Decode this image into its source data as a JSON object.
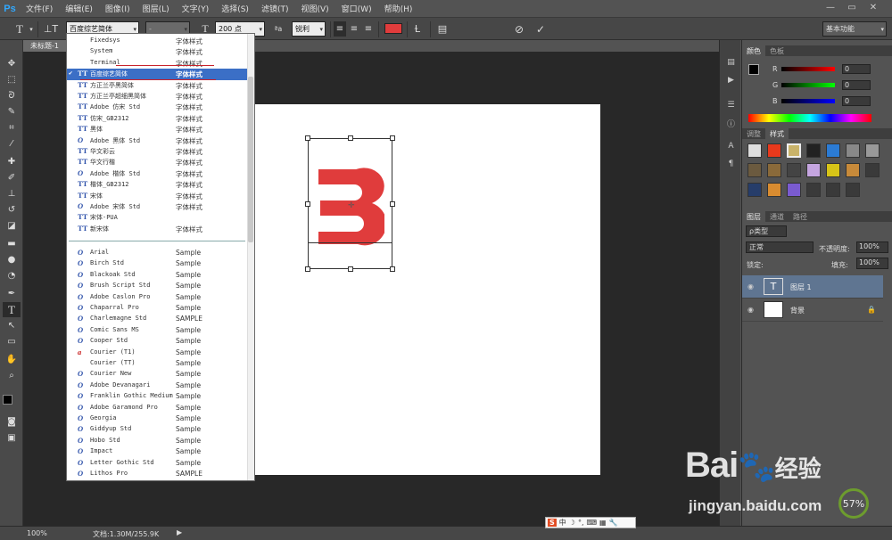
{
  "app": {
    "logo": "Ps"
  },
  "menu": [
    "文件(F)",
    "编辑(E)",
    "图像(I)",
    "图层(L)",
    "文字(Y)",
    "选择(S)",
    "滤镜(T)",
    "视图(V)",
    "窗口(W)",
    "帮助(H)"
  ],
  "window_controls": {
    "minimize": "—",
    "maximize": "▭",
    "close": "✕"
  },
  "options_bar": {
    "font_family": "百度综艺简体",
    "font_style": "-",
    "font_size": "200 点",
    "antialias": "锐利",
    "text_color": "#e03c3c",
    "workspace": "基本功能"
  },
  "document": {
    "tab_title": "未标题-1"
  },
  "font_dropdown": {
    "cjk_fonts": [
      {
        "icon": "",
        "name": "Fixedsys",
        "sample": "字体样式"
      },
      {
        "icon": "",
        "name": "System",
        "sample": "字体样式"
      },
      {
        "icon": "",
        "name": "Terminal",
        "sample": "字体样式"
      },
      {
        "icon": "TT",
        "name": "百度综艺简体",
        "sample": "字体样式",
        "selected": true,
        "check": "✔"
      },
      {
        "icon": "TT",
        "name": "方正兰亭黑简体",
        "sample": "字体样式"
      },
      {
        "icon": "TT",
        "name": "方正兰亭超细黑简体",
        "sample": "字体样式"
      },
      {
        "icon": "TT",
        "name": "Adobe 仿宋 Std",
        "sample": "字体样式"
      },
      {
        "icon": "TT",
        "name": "仿宋_GB2312",
        "sample": "字体样式"
      },
      {
        "icon": "TT",
        "name": "黑体",
        "sample": "字体样式"
      },
      {
        "icon": "O",
        "name": "Adobe 黑体 Std",
        "sample": "字体样式"
      },
      {
        "icon": "TT",
        "name": "华文彩云",
        "sample": "字体样式"
      },
      {
        "icon": "TT",
        "name": "华文行楷",
        "sample": "字体样式"
      },
      {
        "icon": "O",
        "name": "Adobe 楷体 Std",
        "sample": "字体样式"
      },
      {
        "icon": "TT",
        "name": "楷体_GB2312",
        "sample": "字体样式"
      },
      {
        "icon": "TT",
        "name": "宋体",
        "sample": "字体样式"
      },
      {
        "icon": "O",
        "name": "Adobe 宋体 Std",
        "sample": "字体样式"
      },
      {
        "icon": "TT",
        "name": "宋体-PUA",
        "sample": ""
      },
      {
        "icon": "TT",
        "name": "新宋体",
        "sample": "字体样式"
      }
    ],
    "latin_fonts": [
      {
        "icon": "O",
        "name": "Arial",
        "sample": "Sample"
      },
      {
        "icon": "O",
        "name": "Birch Std",
        "sample": "Sample"
      },
      {
        "icon": "O",
        "name": "Blackoak Std",
        "sample": "Sample"
      },
      {
        "icon": "O",
        "name": "Brush Script Std",
        "sample": "Sample"
      },
      {
        "icon": "O",
        "name": "Adobe Caslon Pro",
        "sample": "Sample"
      },
      {
        "icon": "O",
        "name": "Chaparral Pro",
        "sample": "Sample"
      },
      {
        "icon": "O",
        "name": "Charlemagne Std",
        "sample": "SAMPLE"
      },
      {
        "icon": "O",
        "name": "Comic Sans MS",
        "sample": "Sample"
      },
      {
        "icon": "O",
        "name": "Cooper Std",
        "sample": "Sample"
      },
      {
        "icon": "a",
        "name": "Courier (T1)",
        "sample": "Sample"
      },
      {
        "icon": "",
        "name": "Courier (TT)",
        "sample": "Sample"
      },
      {
        "icon": "O",
        "name": "Courier New",
        "sample": "Sample"
      },
      {
        "icon": "O",
        "name": "Adobe Devanagari",
        "sample": "Sample"
      },
      {
        "icon": "O",
        "name": "Franklin Gothic Medium",
        "sample": "Sample"
      },
      {
        "icon": "O",
        "name": "Adobe Garamond Pro",
        "sample": "Sample"
      },
      {
        "icon": "O",
        "name": "Georgia",
        "sample": "Sample"
      },
      {
        "icon": "O",
        "name": "Giddyup Std",
        "sample": "Sample"
      },
      {
        "icon": "O",
        "name": "Hobo Std",
        "sample": "Sample"
      },
      {
        "icon": "O",
        "name": "Impact",
        "sample": "Sample"
      },
      {
        "icon": "O",
        "name": "Letter Gothic Std",
        "sample": "Sample"
      },
      {
        "icon": "O",
        "name": "Lithos Pro",
        "sample": "SAMPLE"
      }
    ]
  },
  "canvas": {
    "glyph": "3",
    "glyph_color": "#e03c3c"
  },
  "color_panel": {
    "tabs": [
      "颜色",
      "色板"
    ],
    "channels": [
      {
        "label": "R",
        "value": "0"
      },
      {
        "label": "G",
        "value": "0"
      },
      {
        "label": "B",
        "value": "0"
      }
    ]
  },
  "styles_panel": {
    "tabs": [
      "调整",
      "样式"
    ]
  },
  "layers_panel": {
    "tabs": [
      "图层",
      "通道",
      "路径"
    ],
    "filter_kind": "ρ类型",
    "blend_mode": "正常",
    "opacity_label": "不透明度:",
    "opacity_value": "100%",
    "lock_label": "锁定:",
    "fill_label": "填充:",
    "fill_value": "100%",
    "layers": [
      {
        "name": "图层 1",
        "thumb": "T",
        "selected": true
      },
      {
        "name": "背景",
        "thumb": "",
        "locked": true
      }
    ]
  },
  "status": {
    "zoom": "100%",
    "doc_info": "文档:1.30M/255.9K"
  },
  "ime": {
    "label": "中"
  },
  "watermark": {
    "logo": "Bai",
    "paw": "🐾",
    "logo_suffix": "经验",
    "url": "jingyan.baidu.com"
  },
  "gauge": {
    "value": "57%"
  },
  "colors": {
    "ps_blue": "#31a8ff",
    "selection": "#3b6fc6",
    "layer_selected": "#5f7591"
  }
}
